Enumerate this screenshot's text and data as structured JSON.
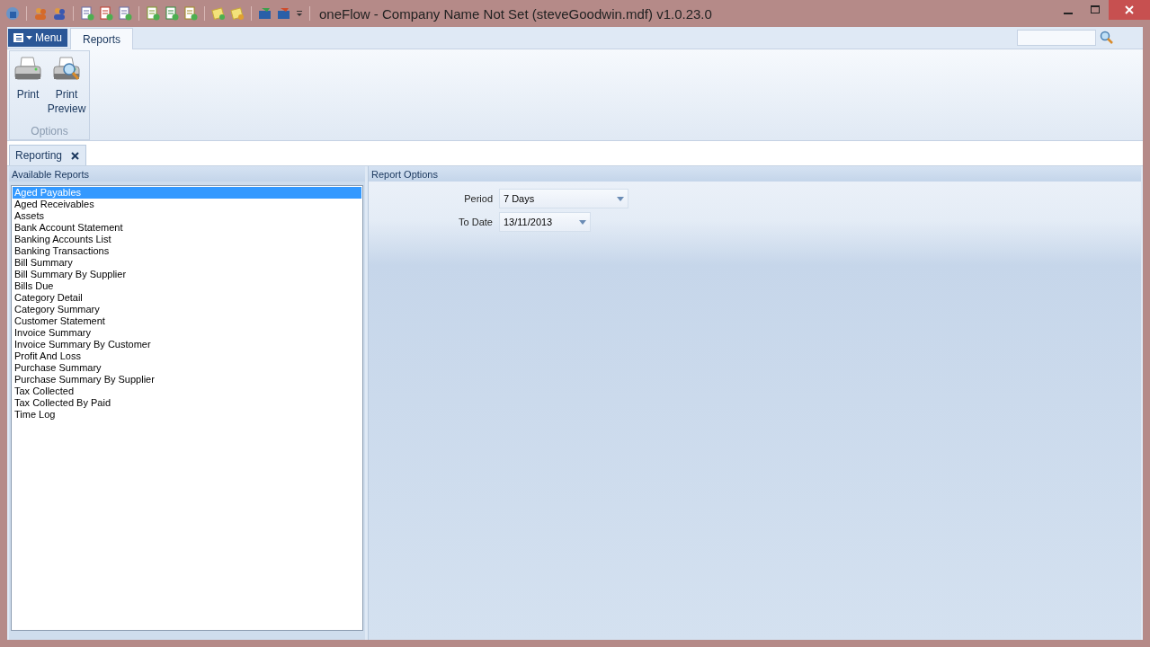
{
  "window": {
    "title": "oneFlow - Company Name Not Set (steveGoodwin.mdf) v1.0.23.0"
  },
  "ribbon": {
    "menu_button": "Menu",
    "tabs": [
      {
        "label": "Reports",
        "selected": true
      }
    ],
    "buttons": [
      {
        "label": "Print",
        "kind": "print"
      },
      {
        "label": "Print Preview",
        "kind": "preview"
      }
    ],
    "group_label": "Options"
  },
  "document_tabs": [
    {
      "label": "Reporting",
      "selected": true
    }
  ],
  "available_reports": {
    "title": "Available Reports",
    "items": [
      {
        "label": "Aged Payables",
        "selected": true
      },
      {
        "label": "Aged Receivables",
        "selected": false
      },
      {
        "label": "Assets",
        "selected": false
      },
      {
        "label": "Bank Account Statement",
        "selected": false
      },
      {
        "label": "Banking Accounts List",
        "selected": false
      },
      {
        "label": "Banking Transactions",
        "selected": false
      },
      {
        "label": "Bill Summary",
        "selected": false
      },
      {
        "label": "Bill Summary By Supplier",
        "selected": false
      },
      {
        "label": "Bills Due",
        "selected": false
      },
      {
        "label": "Category Detail",
        "selected": false
      },
      {
        "label": "Category Summary",
        "selected": false
      },
      {
        "label": "Customer Statement",
        "selected": false
      },
      {
        "label": "Invoice Summary",
        "selected": false
      },
      {
        "label": "Invoice Summary By Customer",
        "selected": false
      },
      {
        "label": "Profit And Loss",
        "selected": false
      },
      {
        "label": "Purchase Summary",
        "selected": false
      },
      {
        "label": "Purchase Summary By Supplier",
        "selected": false
      },
      {
        "label": "Tax Collected",
        "selected": false
      },
      {
        "label": "Tax Collected By Paid",
        "selected": false
      },
      {
        "label": "Time Log",
        "selected": false
      }
    ]
  },
  "report_options": {
    "title": "Report Options",
    "fields": [
      {
        "label": "Period",
        "value": "7 Days",
        "kind": "wide"
      },
      {
        "label": "To Date",
        "value": "13/11/2013",
        "kind": "date"
      }
    ]
  }
}
